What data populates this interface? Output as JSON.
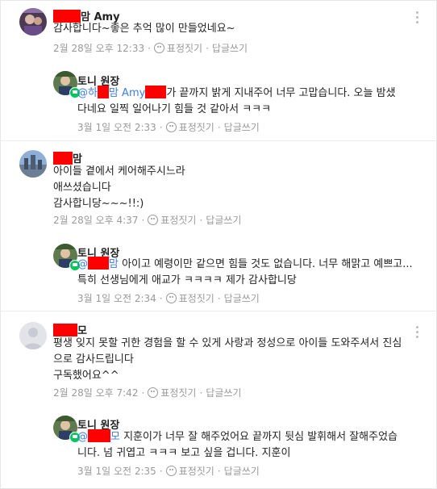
{
  "comments": [
    {
      "author_suffix": "맘 Amy",
      "text_lines": [
        "감사합니다~좋은 추억 많이 만들었네요~"
      ],
      "date": "2월 28일 오후 12:33",
      "emoji_label": "표정짓기",
      "reply_label": "답글쓰기",
      "reply": {
        "author": "토니 원장",
        "mention_prefix": "@하",
        "mention_suffix": "맘 Amy",
        "line1_rest": "가 끝까지 밝게 지내주어 너무 고맙습니다. 오늘 밤샜",
        "line2": "다네요 일찍 일어나기 힘들 것 같아서 ㅋㅋㅋ",
        "date": "3월 1일 오전 2:33",
        "emoji_label": "표정짓기",
        "reply_label": "답글쓰기"
      }
    },
    {
      "author_suffix": "맘",
      "text_lines": [
        "아이들 곁에서 케어해주시느라",
        "애쓰셨습니다",
        "감사합니당~~~!!:)"
      ],
      "date": "2월 28일 오후 4:37",
      "emoji_label": "표정짓기",
      "reply_label": "답글쓰기",
      "reply": {
        "author": "토니 원장",
        "mention_prefix": "@",
        "mention_suffix": "맘",
        "line1_rest": " 아이고 예령이만 같으면 힘들 것도 없습니다. 너무 해맑고 예쁘고...",
        "line2": "특히 선생님에게 애교가 ㅋㅋㅋㅋ 제가 감사합니당",
        "date": "3월 1일 오전 2:34",
        "emoji_label": "표정짓기",
        "reply_label": "답글쓰기"
      }
    },
    {
      "author_suffix": "모",
      "text_lines": [
        "평생 잊지 못할 귀한 경험을 할 수 있게 사랑과 정성으로 아이들 도와주셔서 진심",
        "으로 감사드립니다",
        "구독했어요^^"
      ],
      "date": "2월 28일 오후 7:42",
      "emoji_label": "표정짓기",
      "reply_label": "답글쓰기",
      "reply": {
        "author": "토니 원장",
        "mention_prefix": "@",
        "mention_suffix": "모",
        "line1_rest": " 지훈이가 너무 잘 해주었어요 끝까지 뒷심 발휘해서 잘해주었습",
        "line2": "니다. 넘 귀엽고 ㅋㅋㅋ 보고 싶을 겁니다. 지훈이",
        "date": "3월 1일 오전 2:35",
        "emoji_label": "표정짓기",
        "reply_label": "답글쓰기"
      }
    }
  ],
  "colors": {
    "redaction": "#ff0000",
    "mention": "#3c7ee8",
    "meta": "#999999",
    "manager_badge": "#03c75a"
  },
  "icons": [
    "more-icon",
    "smile-icon",
    "manager-badge-icon"
  ]
}
